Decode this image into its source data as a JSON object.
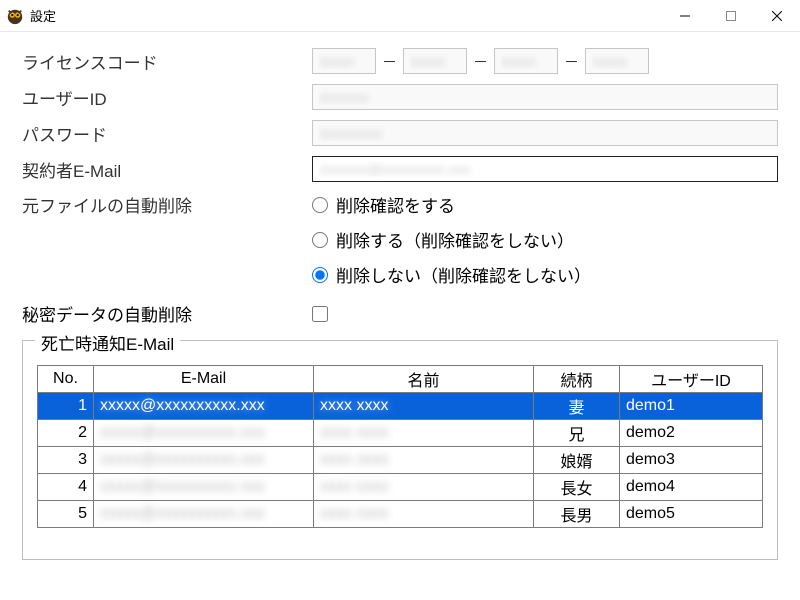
{
  "window": {
    "title": "設定",
    "min_tip": "Minimize",
    "max_tip": "Maximize",
    "close_tip": "Close"
  },
  "form": {
    "license_label": "ライセンスコード",
    "license_seg1": "xxxxx",
    "license_seg2": "xxxxx",
    "license_seg3": "xxxxx",
    "license_seg4": "xxxxx",
    "dash": "－",
    "userid_label": "ユーザーID",
    "userid_value": "xxxxxxx",
    "password_label": "パスワード",
    "password_value": "xxxxxxxxx",
    "contractor_email_label": "契約者E-Mail",
    "contractor_email_value": "xxxxxxx@xxxxxxxxx.xxx",
    "autodelete_label": "元ファイルの自動削除",
    "radio1": "削除確認をする",
    "radio2": "削除する（削除確認をしない）",
    "radio3": "削除しない（削除確認をしない）",
    "secret_autodelete_label": "秘密データの自動削除"
  },
  "group": {
    "legend": "死亡時通知E-Mail",
    "headers": {
      "no": "No.",
      "email": "E-Mail",
      "name": "名前",
      "rel": "続柄",
      "uid": "ユーザーID"
    },
    "rows": [
      {
        "no": "1",
        "email": "xxxxx@xxxxxxxxxx.xxx",
        "name": "xxxx xxxx",
        "rel": "妻",
        "uid": "demo1",
        "selected": true
      },
      {
        "no": "2",
        "email": "xxxxx@xxxxxxxxxx.xxx",
        "name": "xxxx xxxx",
        "rel": "兄",
        "uid": "demo2",
        "selected": false
      },
      {
        "no": "3",
        "email": "xxxxx@xxxxxxxxxx.xxx",
        "name": "xxxx xxxx",
        "rel": "娘婿",
        "uid": "demo3",
        "selected": false
      },
      {
        "no": "4",
        "email": "xxxxx@xxxxxxxxxx.xxx",
        "name": "xxxx xxxx",
        "rel": "長女",
        "uid": "demo4",
        "selected": false
      },
      {
        "no": "5",
        "email": "xxxxx@xxxxxxxxxx.xxx",
        "name": "xxxx xxxx",
        "rel": "長男",
        "uid": "demo5",
        "selected": false
      }
    ]
  }
}
